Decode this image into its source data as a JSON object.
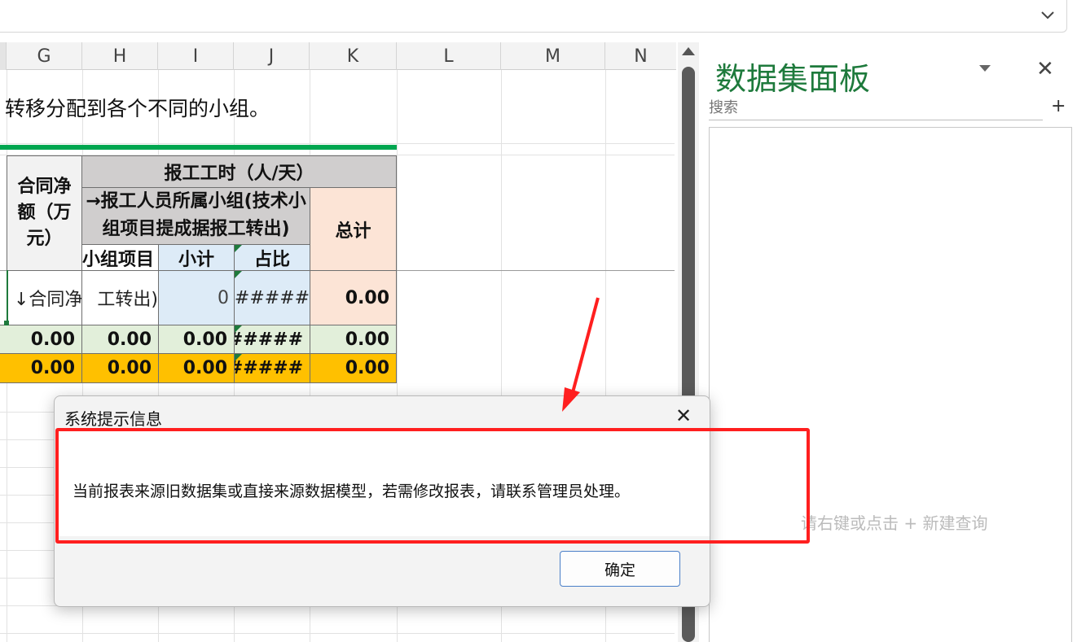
{
  "columns": [
    "G",
    "H",
    "I",
    "J",
    "K",
    "L",
    "M",
    "N"
  ],
  "sheet": {
    "title_text": "转移分配到各个不同的小组。",
    "header_main": "报工工时（人/天）",
    "header_contract": "合同净额（万元）",
    "header_group_desc": "→报工人员所属小组(技术小组项目提成据报工转出)",
    "header_total": "总计",
    "header_sub_group": "小组项目",
    "header_sub_subtotal": "小计",
    "header_sub_ratio": "占比",
    "row1": {
      "g": "↓合同净",
      "h": "工转出)",
      "i": "0",
      "j": "#####",
      "k": "0.00"
    },
    "row2": {
      "g": "0.00",
      "h": "0.00",
      "i": "0.00",
      "j": "#####",
      "k": "0.00"
    },
    "row3": {
      "g": "0.00",
      "h": "0.00",
      "i": "0.00",
      "j": "#####",
      "k": "0.00"
    },
    "colors": {
      "header_gray": "#d0cece",
      "total_peach": "#fce4d6",
      "blue_cell": "#ddebf7",
      "green_row": "#e2efda",
      "orange_row": "#ffc000",
      "accent_green": "#00a650"
    }
  },
  "panel": {
    "title": "数据集面板",
    "search_placeholder": "搜索",
    "add_label": "+",
    "close_label": "✕",
    "hint": "请右键或点击 + 新建查询"
  },
  "dialog": {
    "title": "系统提示信息",
    "close_label": "✕",
    "message": "当前报表来源旧数据集或直接来源数据模型，若需修改报表，请联系管理员处理。",
    "ok_label": "确定"
  },
  "icons": {
    "formula_expand": "chevron-down-icon",
    "panel_dropdown": "caret-down-icon",
    "scroll_up": "arrow-up-icon"
  },
  "annotation_color": "#ff1f1f"
}
